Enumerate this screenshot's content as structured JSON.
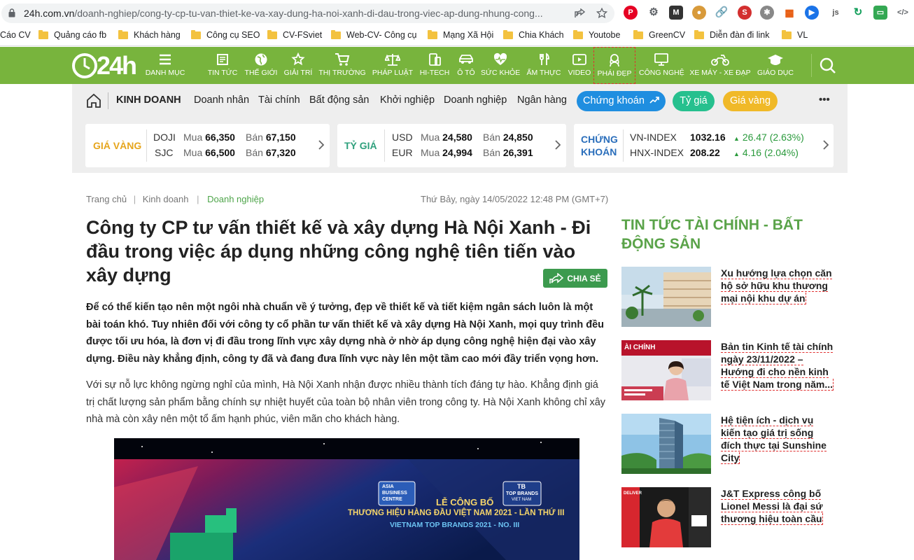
{
  "browser": {
    "url_host": "24h.com.vn",
    "url_path": "/doanh-nghiep/cong-ty-cp-tu-van-thiet-ke-va-xay-dung-ha-noi-xanh-di-dau-trong-viec-ap-dung-nhung-cong...",
    "bookmarks": [
      "Cáo CV",
      "Quảng cáo fb",
      "Khách hàng",
      "Công cụ SEO",
      "CV-FSviet",
      "Web-CV- Công cụ",
      "Mạng Xã Hội",
      "Chia Khách",
      "Youtobe",
      "GreenCV",
      "Diễn đàn đi link",
      "VL"
    ]
  },
  "site": {
    "logo_text": "24h",
    "nav": [
      {
        "label": "DANH MỤC",
        "icon": "menu-icon"
      },
      {
        "label": "TIN TỨC",
        "icon": "newspaper-icon"
      },
      {
        "label": "THẾ GIỚI",
        "icon": "globe-icon"
      },
      {
        "label": "GIẢI TRÍ",
        "icon": "star-icon"
      },
      {
        "label": "THỊ TRƯỜNG",
        "icon": "cart-icon"
      },
      {
        "label": "PHÁP LUẬT",
        "icon": "scale-icon"
      },
      {
        "label": "HI-TECH",
        "icon": "phone-icon"
      },
      {
        "label": "Ô TÔ",
        "icon": "car-icon"
      },
      {
        "label": "SỨC KHỎE",
        "icon": "heart-icon"
      },
      {
        "label": "ẨM THỰC",
        "icon": "food-icon"
      },
      {
        "label": "VIDEO",
        "icon": "video-icon"
      },
      {
        "label": "PHÁI ĐẸP",
        "icon": "lady-icon"
      },
      {
        "label": "CÔNG NGHỆ",
        "icon": "monitor-icon"
      },
      {
        "label": "XE MÁY - XE ĐẠP",
        "icon": "motorbike-icon"
      },
      {
        "label": "GIÁO DỤC",
        "icon": "graduation-cap-icon"
      }
    ]
  },
  "category": {
    "name": "KINH DOANH",
    "links": [
      "Doanh nhân",
      "Tài chính",
      "Bất động sản",
      "Khởi nghiệp",
      "Doanh nghiệp",
      "Ngân hàng"
    ],
    "pills": [
      "Chứng khoán",
      "Tỷ giá",
      "Giá vàng"
    ],
    "more": "•••"
  },
  "ticker": {
    "gold": {
      "title": "GIÁ VÀNG",
      "rows": [
        {
          "name": "DOJI",
          "buy_label": "Mua",
          "buy": "66,350",
          "sell_label": "Bán",
          "sell": "67,150"
        },
        {
          "name": "SJC",
          "buy_label": "Mua",
          "buy": "66,500",
          "sell_label": "Bán",
          "sell": "67,320"
        }
      ]
    },
    "fx": {
      "title": "TỶ GIÁ",
      "rows": [
        {
          "name": "USD",
          "buy_label": "Mua",
          "buy": "24,580",
          "sell_label": "Bán",
          "sell": "24,850"
        },
        {
          "name": "EUR",
          "buy_label": "Mua",
          "buy": "24,994",
          "sell_label": "Bán",
          "sell": "26,391"
        }
      ]
    },
    "stock": {
      "title_line1": "CHỨNG",
      "title_line2": "KHOÁN",
      "rows": [
        {
          "name": "VN-INDEX",
          "value": "1032.16",
          "change": "26.47 (2.63%)"
        },
        {
          "name": "HNX-INDEX",
          "value": "208.22",
          "change": "4.16 (2.04%)"
        }
      ]
    }
  },
  "article": {
    "breadcrumb": [
      "Trang chủ",
      "Kinh doanh",
      "Doanh nghiệp"
    ],
    "datetime": "Thứ Bảy, ngày 14/05/2022 12:48 PM (GMT+7)",
    "title": "Công ty CP tư vấn thiết kế và xây dựng Hà Nội Xanh - Đi đầu trong việc áp dụng những công nghệ tiên tiến vào xây dựng",
    "share_label": "CHIA SẺ",
    "lead": "Để có thể kiến tạo nên một ngôi nhà chuẩn về ý tưởng, đẹp về thiết kế và tiết kiệm ngân sách luôn là một bài toán khó. Tuy nhiên đối với công ty cổ phần tư vấn thiết kế và xây dựng Hà Nội Xanh, mọi quy trình đều được tối ưu hóa, là đơn vị đi đầu trong lĩnh vực xây dựng nhà ở nhờ áp dụng công nghệ hiện đại vào xây dựng. Điều này khẳng định, công ty đã và đang đưa lĩnh vực này lên một tầm cao mới đầy triển vọng hơn.",
    "body1": "Với sự nỗ lực không ngừng nghỉ của mình, Hà Nội Xanh nhận được nhiều thành tích đáng tự hào. Khẳng định giá trị chất lượng sản phẩm bằng chính sự nhiệt huyết của toàn bộ nhân viên trong công ty. Hà Nội Xanh không chỉ xây nhà mà còn xây nên một tổ ấm hạnh phúc, viên mãn cho khách hàng.",
    "hero": {
      "logo1_line1": "ASIA",
      "logo1_line2": "BUSINESS",
      "logo1_line3": "CENTRE",
      "logo2_line1": "TB",
      "logo2_line2": "TOP BRANDS",
      "logo2_line3": "VIET NAM",
      "line1": "LỄ CÔNG BỐ",
      "line2": "THƯƠNG HIỆU HÀNG ĐẦU VIỆT NAM 2021 - LẦN THỨ III",
      "line3": "VIETNAM TOP BRANDS 2021 - NO. III"
    }
  },
  "sidebar": {
    "title": "TIN TỨC TÀI CHÍNH - BẤT ĐỘNG SẢN",
    "items": [
      {
        "title": "Xu hướng lựa chọn căn hộ sở hữu khu thương mại nội khu dự án"
      },
      {
        "title": "Bản tin Kinh tế tài chính ngày 23/11/2022 – Hướng đi cho nền kinh tế Việt Nam trong năm...",
        "thumb_label": "ÀI CHÍNH"
      },
      {
        "title": "Hệ tiện ích - dịch vụ kiến tạo giá trị sống đích thực tại Sunshine City"
      },
      {
        "title": "J&T Express công bố Lionel Messi là đại sứ thương hiệu toàn cầu",
        "thumb_label": "DELIVER"
      }
    ]
  },
  "colors": {
    "nav_green": "#78b43d",
    "accent_green": "#5aa349",
    "stock_blue": "#2a6ebb",
    "gold": "#e6a51c"
  }
}
